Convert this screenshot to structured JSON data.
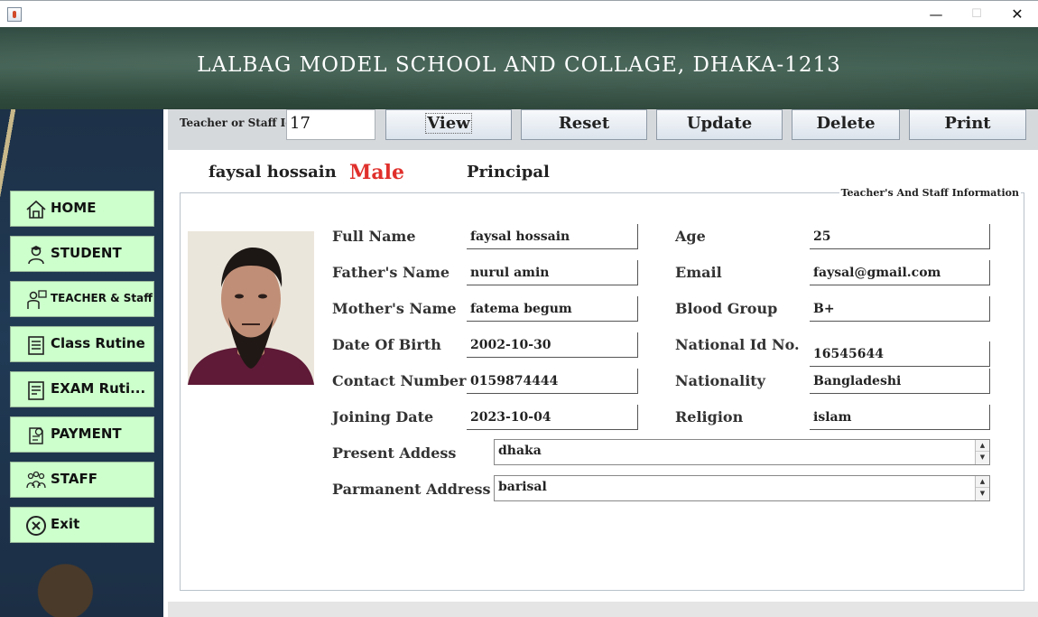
{
  "window": {
    "minimize_glyph": "—",
    "maximize_glyph": "☐",
    "close_glyph": "✕"
  },
  "header": {
    "title": "LALBAG MODEL SCHOOL AND COLLAGE, DHAKA-1213"
  },
  "sidebar": {
    "items": [
      {
        "label": "HOME",
        "icon": "home-icon"
      },
      {
        "label": "STUDENT",
        "icon": "student-icon"
      },
      {
        "label": "TEACHER & Staff",
        "icon": "teacher-icon"
      },
      {
        "label": "Class Rutine",
        "icon": "schedule-icon"
      },
      {
        "label": "EXAM Ruti...",
        "icon": "exam-schedule-icon"
      },
      {
        "label": "PAYMENT",
        "icon": "payment-icon"
      },
      {
        "label": "STAFF",
        "icon": "staff-group-icon"
      },
      {
        "label": "Exit",
        "icon": "exit-icon"
      }
    ]
  },
  "toolbar": {
    "id_label": "Teacher or Staff Id",
    "id_value": "17",
    "view_label": "View",
    "reset_label": "Reset",
    "update_label": "Update",
    "delete_label": "Delete",
    "print_label": "Print"
  },
  "summary": {
    "name": "faysal hossain",
    "gender": "Male",
    "role": "Principal"
  },
  "info": {
    "group_title": "Teacher's And Staff Information",
    "left_fields": [
      {
        "label": "Full Name",
        "value": "faysal hossain"
      },
      {
        "label": "Father's Name",
        "value": "nurul amin"
      },
      {
        "label": "Mother's Name",
        "value": "fatema begum"
      },
      {
        "label": "Date Of Birth",
        "value": "2002-10-30"
      },
      {
        "label": "Contact Number",
        "value": "0159874444"
      },
      {
        "label": "Joining Date",
        "value": "2023-10-04"
      }
    ],
    "right_fields": [
      {
        "label": "Age",
        "value": "25"
      },
      {
        "label": "Email",
        "value": "faysal@gmail.com"
      },
      {
        "label": "Blood Group",
        "value": "B+"
      },
      {
        "label": "National Id No.",
        "value": "16545644"
      },
      {
        "label": "Nationality",
        "value": "Bangladeshi"
      },
      {
        "label": "Religion",
        "value": "islam"
      }
    ],
    "present_address": {
      "label": "Present Addess",
      "value": "dhaka"
    },
    "permanent_address": {
      "label": "Parmanent Address",
      "value": "barisal"
    }
  },
  "colors": {
    "nav_button_bg": "#ccffcc",
    "gender_text": "#e0302c",
    "toolbar_bg": "#d6d9dc"
  }
}
